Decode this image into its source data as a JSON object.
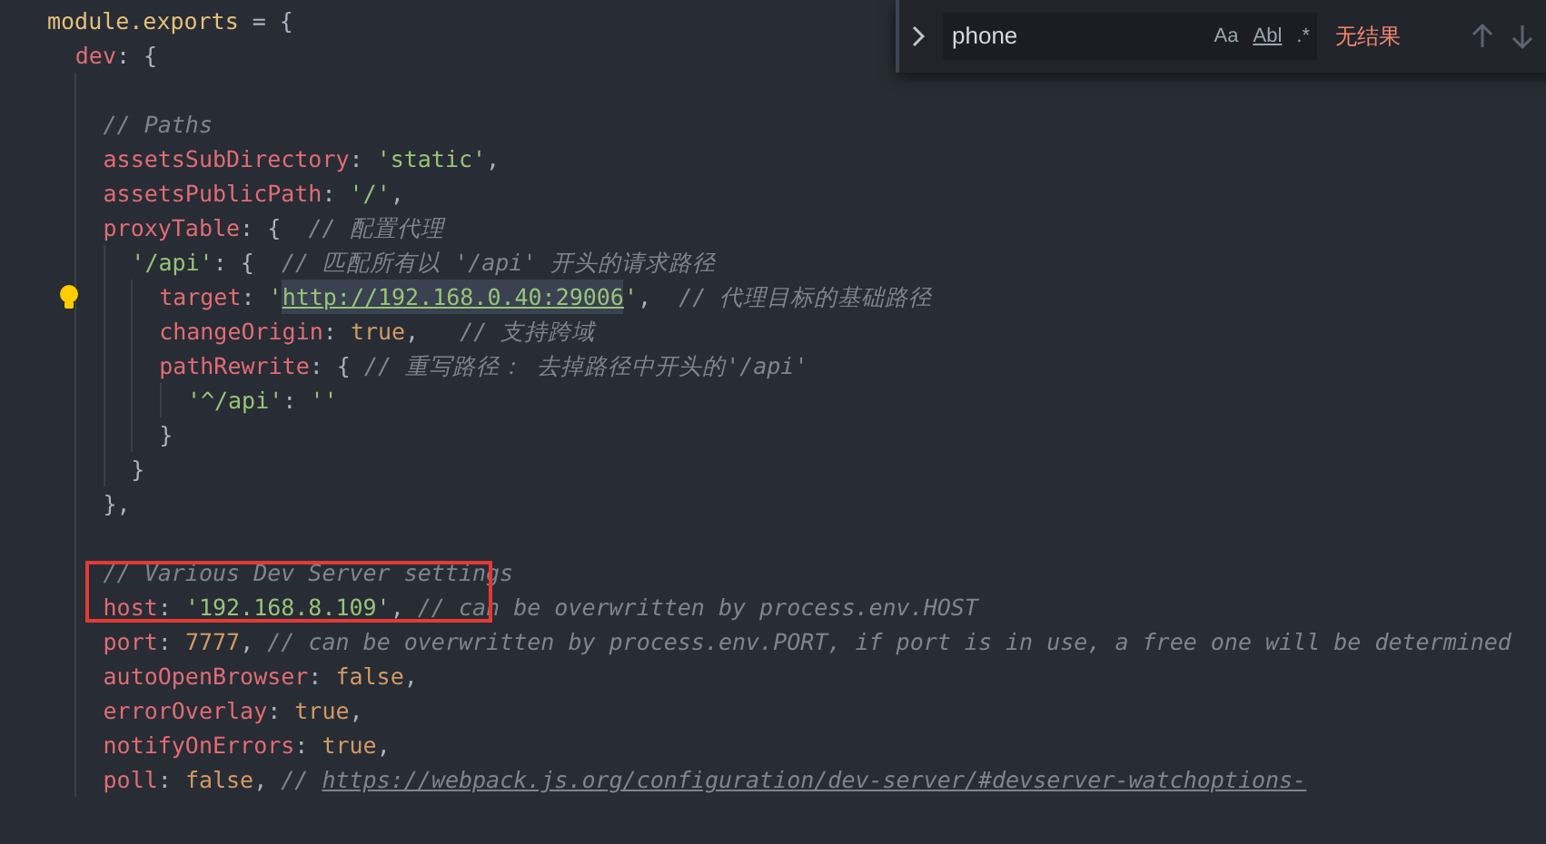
{
  "editor": {
    "lines": [
      {
        "kind": "code",
        "tokens": [
          {
            "kind": "object",
            "text": "module.exports"
          },
          {
            "kind": "punct",
            "text": " = {"
          }
        ],
        "children": [
          {
            "kind": "code",
            "tokens": [
              {
                "kind": "key",
                "text": "dev"
              },
              {
                "kind": "punct",
                "text": ": {"
              }
            ],
            "children": [
              {
                "kind": "blank"
              },
              {
                "kind": "code",
                "tokens": [
                  {
                    "kind": "comment",
                    "text": "// Paths"
                  }
                ]
              },
              {
                "kind": "code",
                "tokens": [
                  {
                    "kind": "key",
                    "text": "assetsSubDirectory"
                  },
                  {
                    "kind": "punct",
                    "text": ": "
                  },
                  {
                    "kind": "string",
                    "text": "'static'"
                  },
                  {
                    "kind": "punct",
                    "text": ","
                  }
                ]
              },
              {
                "kind": "code",
                "tokens": [
                  {
                    "kind": "key",
                    "text": "assetsPublicPath"
                  },
                  {
                    "kind": "punct",
                    "text": ": "
                  },
                  {
                    "kind": "string",
                    "text": "'/'"
                  },
                  {
                    "kind": "punct",
                    "text": ","
                  }
                ]
              },
              {
                "kind": "code",
                "tokens": [
                  {
                    "kind": "key",
                    "text": "proxyTable"
                  },
                  {
                    "kind": "punct",
                    "text": ": {  "
                  },
                  {
                    "kind": "comment",
                    "text": "// 配置代理"
                  }
                ],
                "children": [
                  {
                    "kind": "code",
                    "tokens": [
                      {
                        "kind": "string",
                        "text": "'/api'"
                      },
                      {
                        "kind": "punct",
                        "text": ": {  "
                      },
                      {
                        "kind": "comment",
                        "text": "// 匹配所有以 '/api' 开头的请求路径"
                      }
                    ],
                    "children": [
                      {
                        "kind": "code",
                        "lightbulb": true,
                        "tokens": [
                          {
                            "kind": "key",
                            "text": "target"
                          },
                          {
                            "kind": "punct",
                            "text": ": "
                          },
                          {
                            "kind": "string",
                            "text": "'"
                          },
                          {
                            "kind": "link",
                            "text": "http://192.168.0.40:29006"
                          },
                          {
                            "kind": "string",
                            "text": "'"
                          },
                          {
                            "kind": "punct",
                            "text": ",  "
                          },
                          {
                            "kind": "comment",
                            "text": "// 代理目标的基础路径"
                          }
                        ]
                      },
                      {
                        "kind": "code",
                        "tokens": [
                          {
                            "kind": "key",
                            "text": "changeOrigin"
                          },
                          {
                            "kind": "punct",
                            "text": ": "
                          },
                          {
                            "kind": "bool",
                            "text": "true"
                          },
                          {
                            "kind": "punct",
                            "text": ",   "
                          },
                          {
                            "kind": "comment",
                            "text": "// 支持跨域"
                          }
                        ]
                      },
                      {
                        "kind": "code",
                        "tokens": [
                          {
                            "kind": "key",
                            "text": "pathRewrite"
                          },
                          {
                            "kind": "punct",
                            "text": ": { "
                          },
                          {
                            "kind": "comment",
                            "text": "// 重写路径： 去掉路径中开头的'/api'"
                          }
                        ],
                        "children": [
                          {
                            "kind": "code",
                            "tokens": [
                              {
                                "kind": "string",
                                "text": "'^/api'"
                              },
                              {
                                "kind": "punct",
                                "text": ": "
                              },
                              {
                                "kind": "string",
                                "text": "''"
                              }
                            ]
                          }
                        ]
                      },
                      {
                        "kind": "code",
                        "tokens": [
                          {
                            "kind": "punct",
                            "text": "}"
                          }
                        ]
                      }
                    ]
                  },
                  {
                    "kind": "code",
                    "tokens": [
                      {
                        "kind": "punct",
                        "text": "}"
                      }
                    ]
                  }
                ]
              },
              {
                "kind": "code",
                "tokens": [
                  {
                    "kind": "punct",
                    "text": "},"
                  }
                ]
              },
              {
                "kind": "blank"
              },
              {
                "kind": "code",
                "tokens": [
                  {
                    "kind": "comment",
                    "text": "// Various Dev Server settings"
                  }
                ]
              },
              {
                "kind": "code",
                "tokens": [
                  {
                    "kind": "key",
                    "text": "host"
                  },
                  {
                    "kind": "punct",
                    "text": ": "
                  },
                  {
                    "kind": "string",
                    "text": "'192.168.8.109'"
                  },
                  {
                    "kind": "punct",
                    "text": ", "
                  },
                  {
                    "kind": "comment",
                    "text": "// can be overwritten by process.env.HOST"
                  }
                ]
              },
              {
                "kind": "code",
                "tokens": [
                  {
                    "kind": "key",
                    "text": "port"
                  },
                  {
                    "kind": "punct",
                    "text": ": "
                  },
                  {
                    "kind": "number",
                    "text": "7777"
                  },
                  {
                    "kind": "punct",
                    "text": ", "
                  },
                  {
                    "kind": "comment",
                    "text": "// can be overwritten by process.env.PORT, if port is in use, a free one will be determined"
                  }
                ]
              },
              {
                "kind": "code",
                "tokens": [
                  {
                    "kind": "key",
                    "text": "autoOpenBrowser"
                  },
                  {
                    "kind": "punct",
                    "text": ": "
                  },
                  {
                    "kind": "bool",
                    "text": "false"
                  },
                  {
                    "kind": "punct",
                    "text": ","
                  }
                ]
              },
              {
                "kind": "code",
                "tokens": [
                  {
                    "kind": "key",
                    "text": "errorOverlay"
                  },
                  {
                    "kind": "punct",
                    "text": ": "
                  },
                  {
                    "kind": "bool",
                    "text": "true"
                  },
                  {
                    "kind": "punct",
                    "text": ","
                  }
                ]
              },
              {
                "kind": "code",
                "tokens": [
                  {
                    "kind": "key",
                    "text": "notifyOnErrors"
                  },
                  {
                    "kind": "punct",
                    "text": ": "
                  },
                  {
                    "kind": "bool",
                    "text": "true"
                  },
                  {
                    "kind": "punct",
                    "text": ","
                  }
                ]
              },
              {
                "kind": "code",
                "tokens": [
                  {
                    "kind": "key",
                    "text": "poll"
                  },
                  {
                    "kind": "punct",
                    "text": ": "
                  },
                  {
                    "kind": "bool",
                    "text": "false"
                  },
                  {
                    "kind": "punct",
                    "text": ", "
                  },
                  {
                    "kind": "comment",
                    "text": "// "
                  },
                  {
                    "kind": "link",
                    "text": "https://webpack.js.org/configuration/dev-server/#devserver-watchoptions-"
                  }
                ]
              }
            ]
          }
        ]
      }
    ],
    "highlight_box": {
      "color": "#e53935"
    }
  },
  "find_widget": {
    "value": "phone",
    "options": [
      "Aa",
      "Abl",
      ".*"
    ],
    "result": "无结果"
  }
}
